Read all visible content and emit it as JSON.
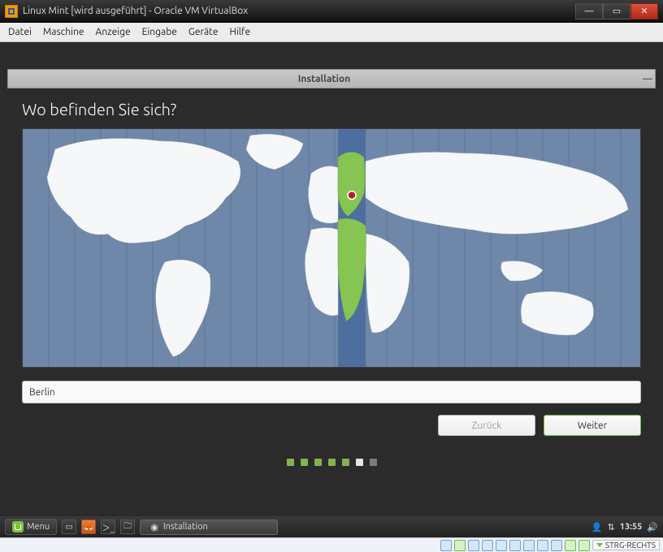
{
  "vbox": {
    "title": "Linux Mint [wird ausgeführt] - Oracle VM VirtualBox",
    "menu": [
      "Datei",
      "Maschine",
      "Anzeige",
      "Eingabe",
      "Geräte",
      "Hilfe"
    ],
    "status_icons": [
      "sata-icon",
      "optical-icon",
      "audio-icon",
      "network-icon",
      "usb-icon",
      "shared-folder-icon",
      "display-icon",
      "clipboard-icon",
      "drag-drop-icon",
      "recording-icon",
      "cpu-icon"
    ],
    "host_key": "STRG-RECHTS"
  },
  "installer": {
    "window_title": "Installation",
    "heading": "Wo befinden Sie sich?",
    "location_value": "Berlin",
    "back_label": "Zurück",
    "next_label": "Weiter",
    "progress": {
      "total": 7,
      "done": 5,
      "current_index": 5
    }
  },
  "mint_panel": {
    "menu_label": "Menu",
    "launcher_icons": [
      "show-desktop-icon",
      "firefox-icon",
      "terminal-icon",
      "files-icon"
    ],
    "task_label": "Installation",
    "tray_icons": [
      "user-icon",
      "network-tray-icon"
    ],
    "clock": "13:55",
    "volume_icon": "volume-icon"
  },
  "colors": {
    "ocean": "#6f87a9",
    "land": "#f6f7f8",
    "highlight": "#87c553",
    "tz_band": "#4f6ea0",
    "pin_outer": "#b02323",
    "pin_inner": "#ffffff"
  }
}
